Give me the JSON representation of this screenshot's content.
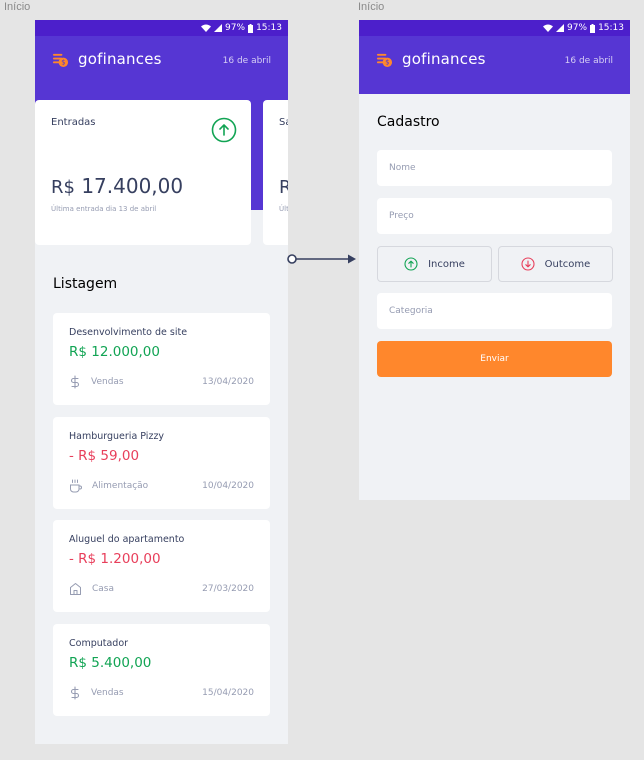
{
  "frames": {
    "left_label": "Início",
    "right_label": "Início"
  },
  "status_bar": {
    "battery": "97%",
    "time": "15:13"
  },
  "app": {
    "name": "gofinances",
    "date": "16 de abril"
  },
  "dashboard": {
    "cards": [
      {
        "title": "Entradas",
        "currency": "R$",
        "amount": "17.400,00",
        "subtitle": "Última entrada dia 13 de abril",
        "icon": "arrow-up-circle-icon"
      },
      {
        "title": "Sa",
        "currency": "R",
        "subtitle": "Últ"
      }
    ],
    "list_title": "Listagem",
    "transactions": [
      {
        "title": "Desenvolvimento de site",
        "amount": "R$ 12.000,00",
        "type": "income",
        "category": "Vendas",
        "category_icon": "dollar-sign-icon",
        "date": "13/04/2020"
      },
      {
        "title": "Hamburgueria Pizzy",
        "amount": "- R$ 59,00",
        "type": "outcome",
        "category": "Alimentação",
        "category_icon": "coffee-icon",
        "date": "10/04/2020"
      },
      {
        "title": "Aluguel do apartamento",
        "amount": "- R$ 1.200,00",
        "type": "outcome",
        "category": "Casa",
        "category_icon": "home-icon",
        "date": "27/03/2020"
      },
      {
        "title": "Computador",
        "amount": "R$ 5.400,00",
        "type": "income",
        "category": "Vendas",
        "category_icon": "dollar-sign-icon",
        "date": "15/04/2020"
      }
    ]
  },
  "register": {
    "title": "Cadastro",
    "name_placeholder": "Nome",
    "price_placeholder": "Preço",
    "income_label": "Income",
    "outcome_label": "Outcome",
    "category_placeholder": "Categoria",
    "submit_label": "Enviar"
  },
  "colors": {
    "header": "#5636d3",
    "status_bar": "#4c1fcb",
    "income": "#12a454",
    "outcome": "#e83f5b",
    "submit": "#ff872c",
    "brand_icon": "#ff872c",
    "background": "#f0f2f5"
  }
}
